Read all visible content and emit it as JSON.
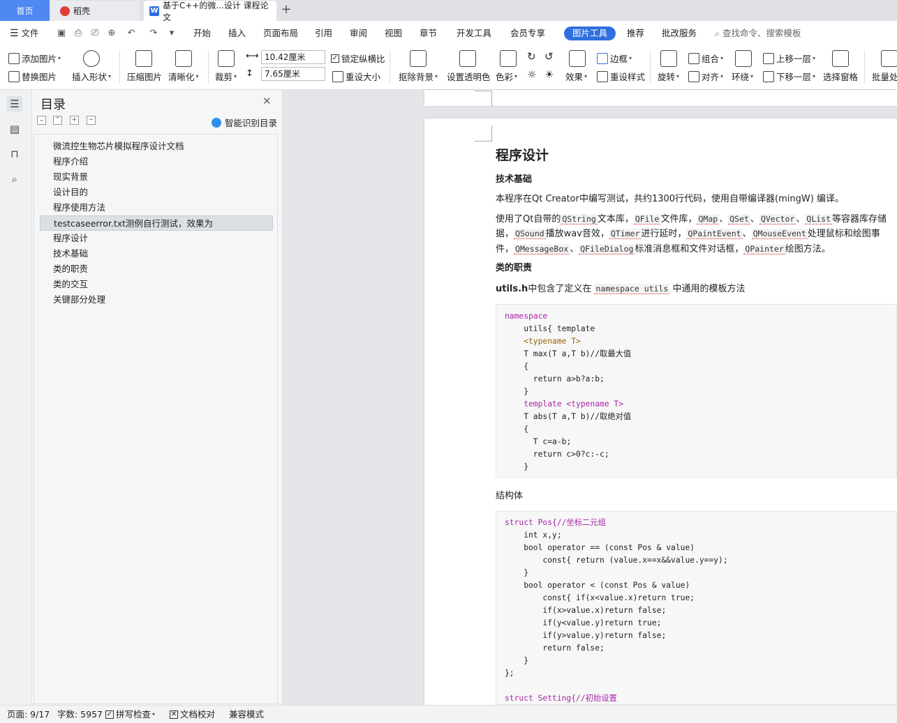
{
  "tabs": {
    "home": "首页",
    "daoke": "稻壳",
    "doc": "基于C++的微...设计 课程论文",
    "new_tab": "+"
  },
  "menu": {
    "file": "文件",
    "items": [
      "开始",
      "插入",
      "页面布局",
      "引用",
      "审阅",
      "视图",
      "章节",
      "开发工具",
      "会员专享"
    ],
    "active": "图片工具",
    "items_right": [
      "推荐",
      "批改服务"
    ],
    "search": "查找命令、搜索模板"
  },
  "ribbon": {
    "add_picture": "添加图片",
    "replace_picture": "替换图片",
    "insert_shape": "插入形状",
    "compress": "压缩图片",
    "sharpen": "清晰化",
    "crop": "裁剪",
    "width_value": "10.42厘米",
    "height_value": "7.65厘米",
    "lock_ratio": "锁定纵横比",
    "reset_size": "重设大小",
    "remove_bg": "抠除背景",
    "transparent": "设置透明色",
    "color": "色彩",
    "effect": "效果",
    "border": "边框",
    "reset_style": "重设样式",
    "rotate": "旋转",
    "group": "组合",
    "align": "对齐",
    "wrap": "环绕",
    "bring_forward": "上移一层",
    "send_backward": "下移一层",
    "selection_pane": "选择窗格",
    "batch": "批量处"
  },
  "toc": {
    "title": "目录",
    "smart": "智能识别目录",
    "items": [
      "微流控生物芯片模拟程序设计文档",
      "程序介绍",
      "现实背景",
      "设计目的",
      "程序使用方法",
      "testcaseerror.txt测例自行测试，效果为",
      "程序设计",
      "技术基础",
      "类的职责",
      "类的交互",
      "关键部分处理"
    ],
    "selected_index": 5
  },
  "doc": {
    "heading": "程序设计",
    "sub1": "技术基础",
    "p1": "本程序在Qt Creator中编写测试，共约1300行代码，使用自带编译器(mingW) 编译。",
    "p2_a": "使用了Qt自带的",
    "p2_qstring": "QString",
    "p2_b": "文本库，",
    "p2_qfile": "QFile",
    "p2_c": "文件库，",
    "p2_qmap": "QMap",
    "p2_sep": "、",
    "p2_qset": "QSet",
    "p2_qvector": "QVector",
    "p2_qlist": "QList",
    "p2_d": "等容器库存储",
    "p3_a": "据，",
    "p3_qsound": "QSound",
    "p3_b": "播放wav音效，",
    "p3_qtimer": "QTimer",
    "p3_c": "进行延时，",
    "p3_qpaintevent": "QPaintEvent",
    "p3_qmouseevent": "QMouseEvent",
    "p3_d": "处理鼠标和绘图事",
    "p4_a": "件，",
    "p4_qmessagebox": "QMessageBox",
    "p4_qfiledialog": "QFileDialog",
    "p4_b": "标准消息框和文件对话框，",
    "p4_qpainter": "QPainter",
    "p4_c": "绘图方法。",
    "sub2": "类的职责",
    "p5_bold": "utils.h",
    "p5_a": "中包含了定义在",
    "p5_ns": "namespace utils",
    "p5_b": "中通用的模板方法",
    "struct_label": "结构体"
  },
  "code1": [
    "namespace",
    "    utils{ template",
    "    <typename T>",
    "    T max(T a,T b)//取最大值",
    "    {",
    "      return a>b?a:b;",
    "    }",
    "    template <typename T>",
    "    T abs(T a,T b)//取绝对值",
    "    {",
    "      T c=a-b;",
    "      return c>0?c:-c;",
    "    }"
  ],
  "code2": [
    "struct Pos{//坐标二元组",
    "    int x,y;",
    "    bool operator == (const Pos & value)",
    "        const{ return (value.x==x&&value.y==y);",
    "    }",
    "    bool operator < (const Pos & value)",
    "        const{ if(x<value.x)return true;",
    "        if(x>value.x)return false;",
    "        if(y<value.y)return true;",
    "        if(y>value.y)return false;",
    "        return false;",
    "    }",
    "};",
    "",
    "struct Setting{//初始设置"
  ],
  "status": {
    "page": "页面: 9/17",
    "words": "字数: 5957",
    "spell": "拼写检查",
    "proof": "文档校对",
    "compat": "兼容模式"
  }
}
